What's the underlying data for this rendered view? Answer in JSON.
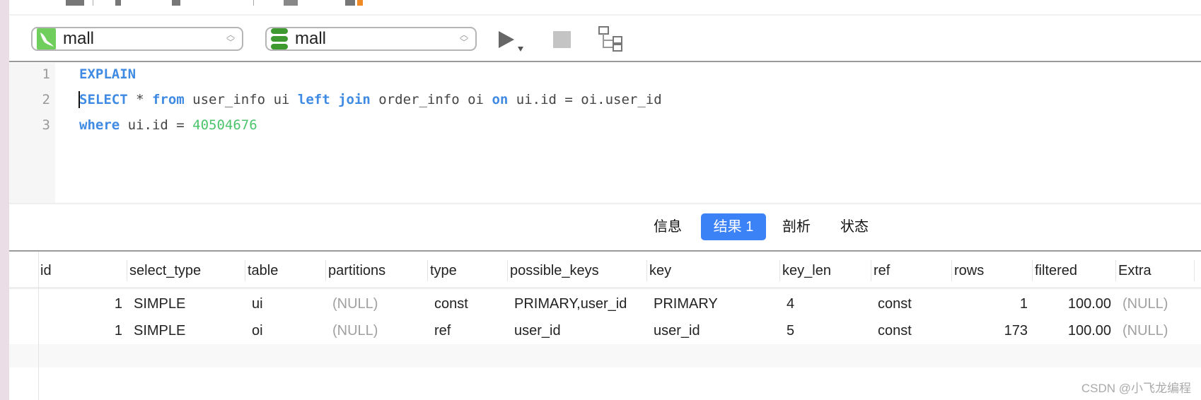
{
  "connection_select": {
    "value": "mall",
    "icon": "mysql-dolphin-icon"
  },
  "database_select": {
    "value": "mall",
    "icon": "database-icon"
  },
  "editor": {
    "line_numbers": [
      "1",
      "2",
      "3"
    ],
    "lines": [
      [
        {
          "t": "EXPLAIN",
          "c": "kw"
        }
      ],
      [
        {
          "t": "SELECT",
          "c": "kw"
        },
        {
          "t": " * "
        },
        {
          "t": "from",
          "c": "kw"
        },
        {
          "t": " user_info ui "
        },
        {
          "t": "left join",
          "c": "kw"
        },
        {
          "t": " order_info oi "
        },
        {
          "t": "on",
          "c": "kw"
        },
        {
          "t": " ui.id = oi.user_id"
        }
      ],
      [
        {
          "t": "where",
          "c": "kw"
        },
        {
          "t": " ui.id = "
        },
        {
          "t": "40504676",
          "c": "num"
        }
      ]
    ]
  },
  "tabs": [
    {
      "label": "信息"
    },
    {
      "label": "结果 1",
      "active": true
    },
    {
      "label": "剖析"
    },
    {
      "label": "状态"
    }
  ],
  "table": {
    "columns": [
      "id",
      "select_type",
      "table",
      "partitions",
      "type",
      "possible_keys",
      "key",
      "key_len",
      "ref",
      "rows",
      "filtered",
      "Extra"
    ],
    "rows": [
      [
        "1",
        "SIMPLE",
        "ui",
        "(NULL)",
        "const",
        "PRIMARY,user_id",
        "PRIMARY",
        "4",
        "const",
        "1",
        "100.00",
        "(NULL)"
      ],
      [
        "1",
        "SIMPLE",
        "oi",
        "(NULL)",
        "ref",
        "user_id",
        "user_id",
        "5",
        "const",
        "173",
        "100.00",
        "(NULL)"
      ]
    ]
  },
  "watermark": "CSDN @小飞龙编程",
  "colors": {
    "keyword": "#3f8ae3",
    "number": "#4cc46c",
    "active_tab": "#3b82f6"
  }
}
